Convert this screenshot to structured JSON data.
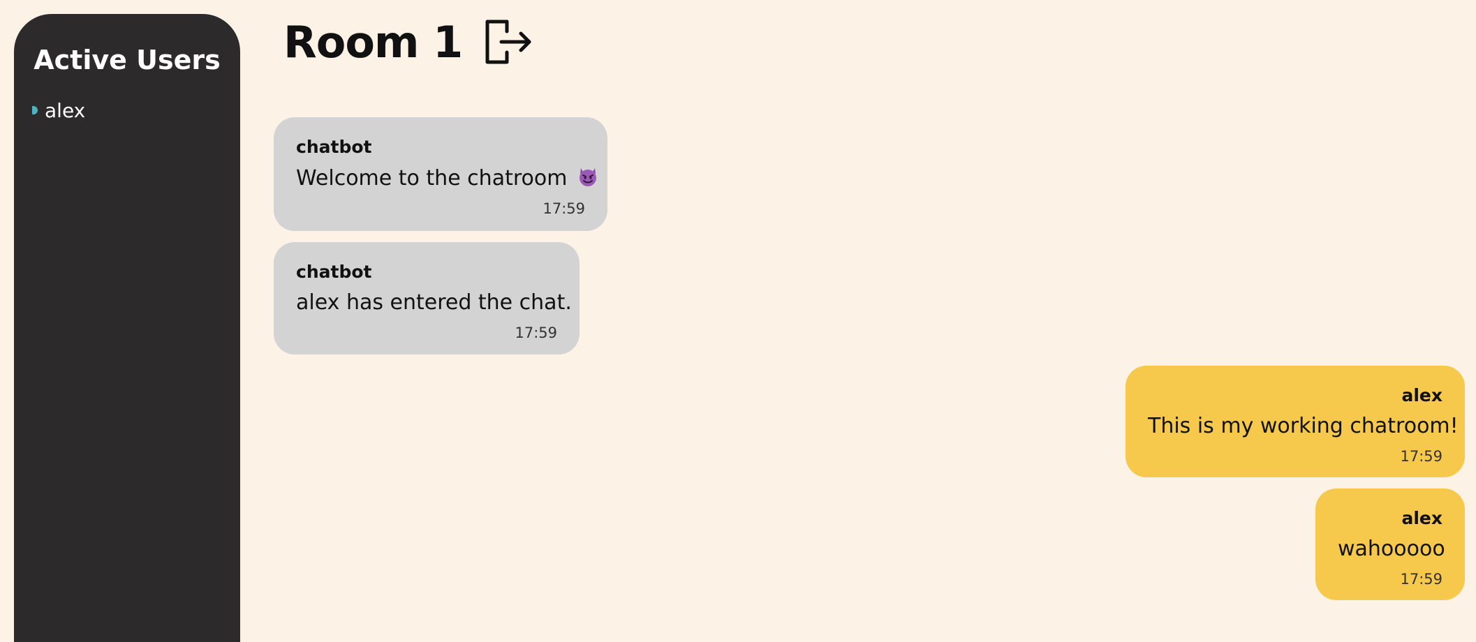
{
  "sidebar": {
    "title": "Active Users",
    "users": [
      {
        "name": "alex",
        "status_color": "#4fb3bf"
      }
    ]
  },
  "header": {
    "room_title": "Room 1",
    "exit_icon": "exit-door-icon"
  },
  "messages": [
    {
      "sender": "chatbot",
      "text": "Welcome to the chatroom",
      "emoji": "smiling-devil-emoji",
      "time": "17:59",
      "side": "other"
    },
    {
      "sender": "chatbot",
      "text": "alex has entered the chat.",
      "time": "17:59",
      "side": "other"
    },
    {
      "sender": "alex",
      "text": "This is my working chatroom!",
      "time": "17:59",
      "side": "self"
    },
    {
      "sender": "alex",
      "text": "wahooooo",
      "time": "17:59",
      "side": "self"
    }
  ],
  "colors": {
    "background": "#fcf3e6",
    "sidebar": "#2d2a2b",
    "other_bubble": "#d3d3d3",
    "self_bubble": "#f6c84b"
  }
}
